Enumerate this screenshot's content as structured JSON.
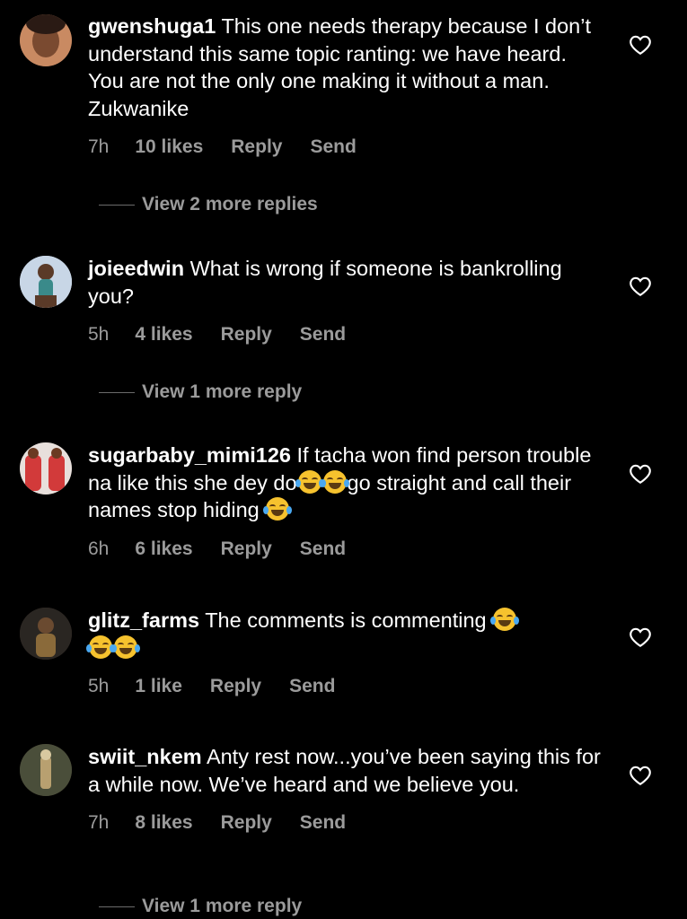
{
  "comments": [
    {
      "username": "gwenshuga1",
      "text": "This one needs therapy because I don’t understand this same topic ranting: we have heard. You are not the only one making it without a man. Zukwanike",
      "time": "7h",
      "likes": "10 likes",
      "reply_label": "Reply",
      "send_label": "Send",
      "view_replies": "View 2 more replies"
    },
    {
      "username": "joieedwin",
      "text": "What is wrong if someone is bankrolling you?",
      "time": "5h",
      "likes": "4 likes",
      "reply_label": "Reply",
      "send_label": "Send",
      "view_replies": "View 1 more reply"
    },
    {
      "username": "sugarbaby_mimi126",
      "text_a": "If tacha won find person trouble na like this she dey do",
      "text_b": "go straight and call their names stop hiding",
      "time": "6h",
      "likes": "6 likes",
      "reply_label": "Reply",
      "send_label": "Send"
    },
    {
      "username": "glitz_farms",
      "text": "The comments is commenting",
      "time": "5h",
      "likes": "1 like",
      "reply_label": "Reply",
      "send_label": "Send"
    },
    {
      "username": "swiit_nkem",
      "text": "Anty rest now...you’ve been saying this for a while now. We’ve heard and we believe you.",
      "time": "7h",
      "likes": "8 likes",
      "reply_label": "Reply",
      "send_label": "Send",
      "view_replies": "View 1 more reply"
    }
  ],
  "icons": {
    "like": "heart-outline-icon",
    "emoji": "face-with-tears-of-joy"
  },
  "colors": {
    "background": "#000000",
    "text": "#ffffff",
    "meta": "#9b9b9b"
  }
}
